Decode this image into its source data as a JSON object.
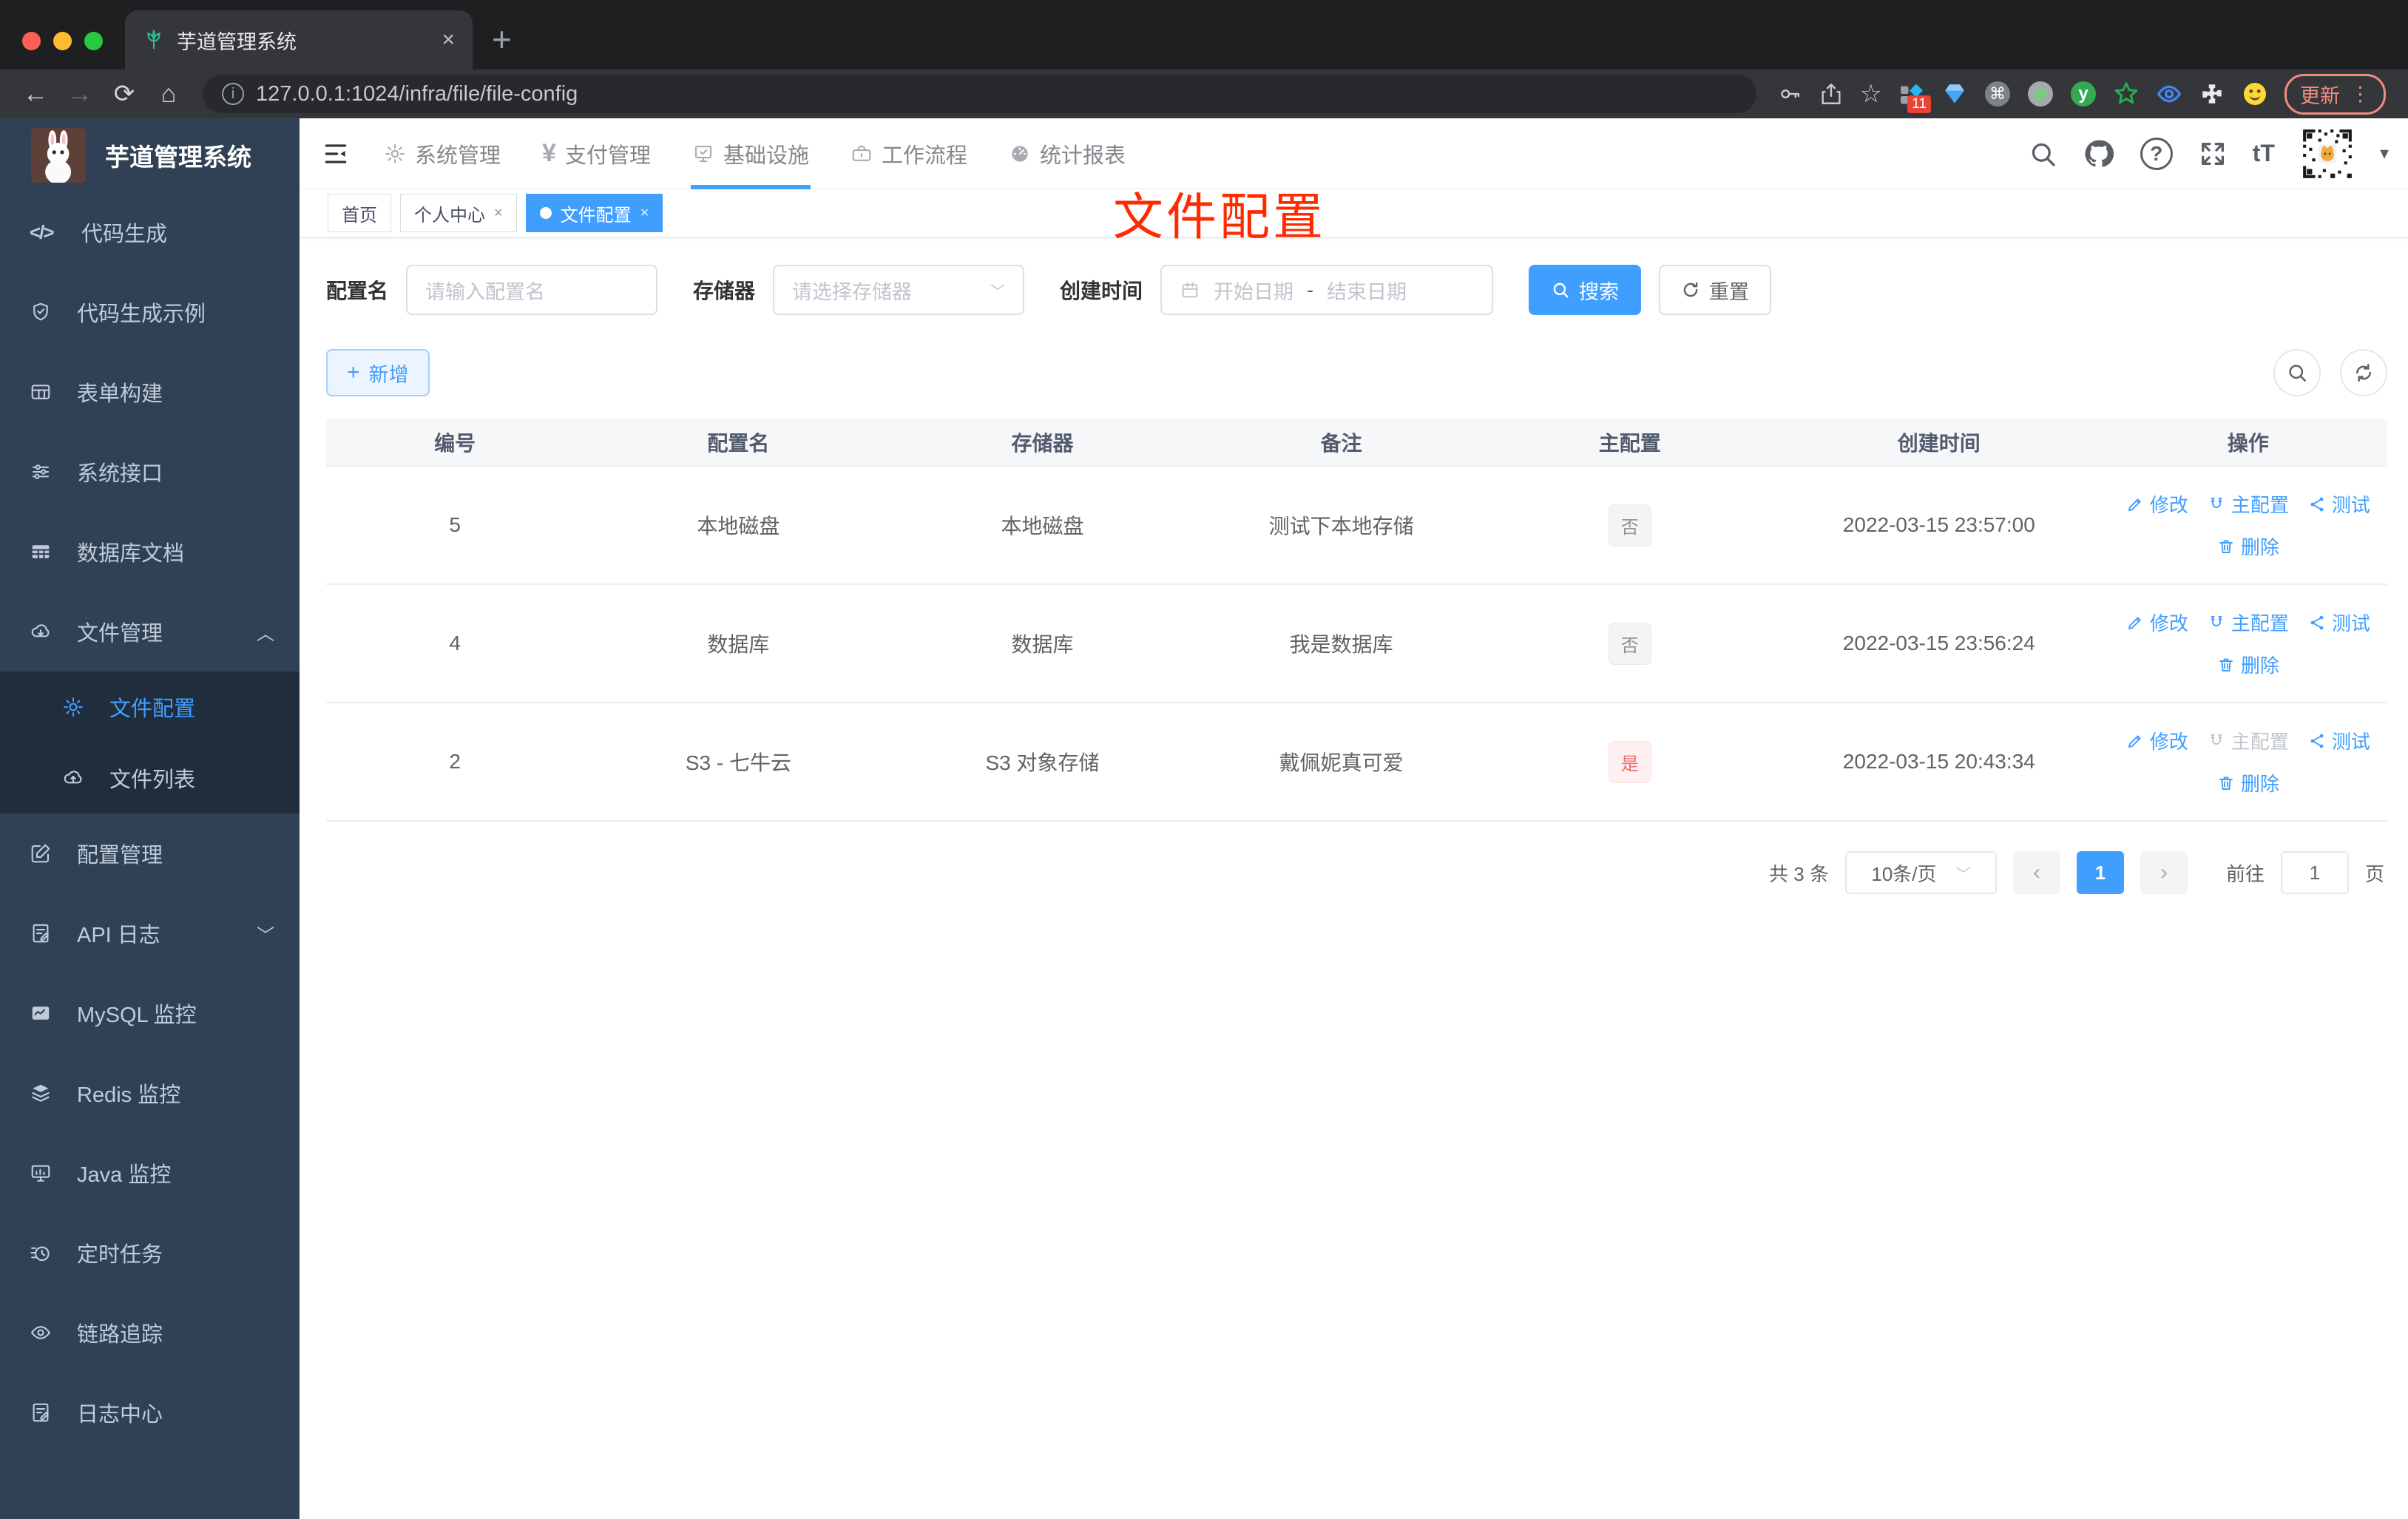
{
  "browser": {
    "tab": {
      "title": "芋道管理系统",
      "close": "×"
    },
    "new_tab": "+",
    "nav": {
      "back": "←",
      "forward": "→",
      "reload": "⟳",
      "home": "⌂"
    },
    "url": "127.0.0.1:1024/infra/file/file-config",
    "info_glyph": "ⓘ",
    "star_glyph": "☆",
    "cmd_glyph": "⌘",
    "ext_badge": "11",
    "ext_y_glyph": "y",
    "update_label": "更新",
    "kebab": "⋮",
    "traffic": {
      "red": "#ff5f57",
      "yellow": "#febc2e",
      "green": "#28c840"
    }
  },
  "sidebar": {
    "title": "芋道管理系统",
    "items": [
      {
        "label": "代码生成"
      },
      {
        "label": "代码生成示例"
      },
      {
        "label": "表单构建"
      },
      {
        "label": "系统接口"
      },
      {
        "label": "数据库文档"
      },
      {
        "label": "文件管理",
        "chevron": "︿"
      }
    ],
    "submenu": [
      {
        "label": "文件配置"
      },
      {
        "label": "文件列表"
      }
    ],
    "items2": [
      {
        "label": "配置管理"
      },
      {
        "label": "API 日志",
        "chevron": "﹀"
      },
      {
        "label": "MySQL 监控"
      },
      {
        "label": "Redis 监控"
      },
      {
        "label": "Java 监控"
      },
      {
        "label": "定时任务"
      },
      {
        "label": "链路追踪"
      },
      {
        "label": "日志中心"
      }
    ],
    "code_glyph": "</>"
  },
  "header": {
    "nav": [
      {
        "label": "系统管理"
      },
      {
        "label": "支付管理"
      },
      {
        "label": "基础设施"
      },
      {
        "label": "工作流程"
      },
      {
        "label": "统计报表"
      }
    ],
    "yen_glyph": "¥",
    "help_glyph": "?",
    "font_size_label": "tT",
    "caret": "▾"
  },
  "tags": [
    {
      "label": "首页"
    },
    {
      "label": "个人中心"
    },
    {
      "label": "文件配置"
    }
  ],
  "tags_meta": {
    "close": "×"
  },
  "annotation": "文件配置",
  "filters": {
    "name_label": "配置名",
    "name_placeholder": "请输入配置名",
    "storage_label": "存储器",
    "storage_placeholder": "请选择存储器",
    "storage_chevron": "﹀",
    "time_label": "创建时间",
    "time_start": "开始日期",
    "time_sep": "-",
    "time_end": "结束日期",
    "search_label": "搜索",
    "reset_label": "重置"
  },
  "toolbar": {
    "add_label": "新增",
    "add_plus": "+"
  },
  "table": {
    "headers": [
      "编号",
      "配置名",
      "存储器",
      "备注",
      "主配置",
      "创建时间",
      "操作"
    ],
    "actions": {
      "edit": "修改",
      "master": "主配置",
      "test": "测试",
      "delete": "删除"
    },
    "rows": [
      {
        "id": "5",
        "name": "本地磁盘",
        "storage": "本地磁盘",
        "remark": "测试下本地存储",
        "master": "否",
        "created": "2022-03-15 23:57:00"
      },
      {
        "id": "4",
        "name": "数据库",
        "storage": "数据库",
        "remark": "我是数据库",
        "master": "否",
        "created": "2022-03-15 23:56:24"
      },
      {
        "id": "2",
        "name": "S3 - 七牛云",
        "storage": "S3 对象存储",
        "remark": "戴佩妮真可爱",
        "master": "是",
        "created": "2022-03-15 20:43:34"
      }
    ]
  },
  "pagination": {
    "total": "共 3 条",
    "size": "10条/页",
    "size_chevron": "﹀",
    "prev": "‹",
    "page": "1",
    "next": "›",
    "goto": "前往",
    "goto_value": "1",
    "unit": "页"
  },
  "colors": {
    "primary": "#409eff",
    "danger": "#f56c6c",
    "sidebar_bg": "#304156",
    "submenu_bg": "#1f2d3d",
    "annotation": "#ff2a00"
  }
}
